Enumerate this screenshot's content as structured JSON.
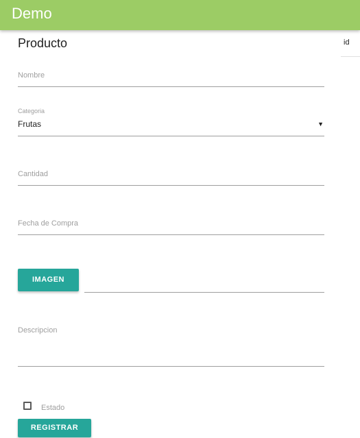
{
  "appbar": {
    "title": "Demo"
  },
  "form": {
    "title": "Producto",
    "nombre": {
      "label": "Nombre",
      "value": ""
    },
    "categoria": {
      "label": "Categoria",
      "value": "Frutas",
      "arrow": "▼"
    },
    "cantidad": {
      "label": "Cantidad",
      "value": ""
    },
    "fecha": {
      "label": "Fecha de Compra",
      "value": ""
    },
    "imagen": {
      "button_label": "IMAGEN",
      "value": ""
    },
    "descripcion": {
      "label": "Descripcion",
      "value": ""
    },
    "estado": {
      "label": "Estado",
      "checked": false
    },
    "submit_label": "REGISTRAR"
  },
  "side_table": {
    "column_header": "id"
  },
  "colors": {
    "appbar": "#9ccc65",
    "button": "#26a69a"
  }
}
